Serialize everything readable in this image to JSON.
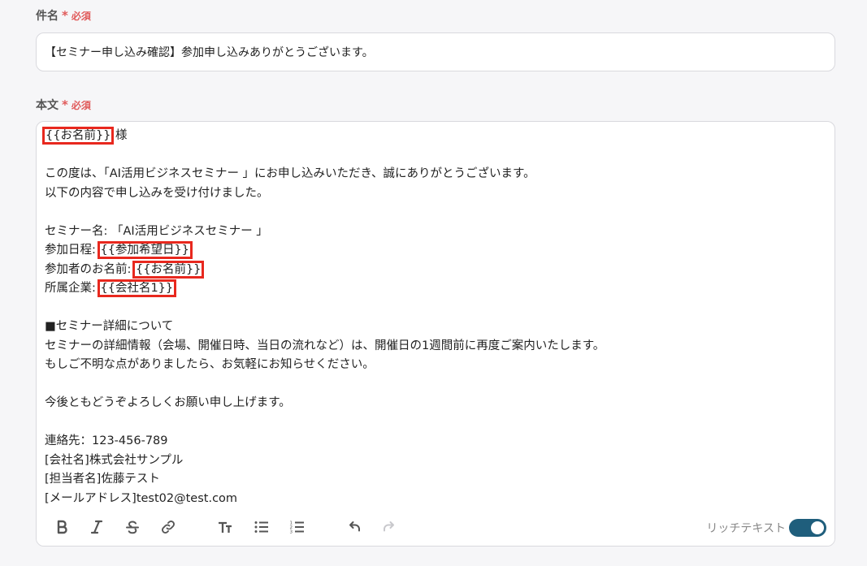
{
  "subject": {
    "label": "件名",
    "required_mark": "*",
    "required_text": "必須",
    "value": "【セミナー申し込み確認】参加申し込みありがとうございます。"
  },
  "body": {
    "label": "本文",
    "required_mark": "*",
    "required_text": "必須",
    "lines": {
      "l1_var": "{{お名前}}",
      "l1_text": " 様",
      "l3": "この度は、「AI活用ビジネスセミナー 」にお申し込みいただき、誠にありがとうございます。",
      "l4": "以下の内容で申し込みを受け付けました。",
      "l6": "セミナー名: 「AI活用ビジネスセミナー 」",
      "l7_text": "参加日程: ",
      "l7_var": "{{参加希望日}}",
      "l8_text": "参加者のお名前: ",
      "l8_var": "{{お名前}}",
      "l9_text": "所属企業: ",
      "l9_var": "{{会社名1}}",
      "l11": "■セミナー詳細について",
      "l12": "セミナーの詳細情報（会場、開催日時、当日の流れなど）は、開催日の1週間前に再度ご案内いたします。",
      "l13": "もしご不明な点がありましたら、お気軽にお知らせください。",
      "l15": "今後ともどうぞよろしくお願い申し上げます。",
      "l17": "連絡先：123-456-789",
      "l18": "[会社名]株式会社サンプル",
      "l19": "[担当者名]佐藤テスト",
      "l20": "[メールアドレス]test02@test.com"
    }
  },
  "toolbar": {
    "icons": [
      "bold-icon",
      "italic-icon",
      "strikethrough-icon",
      "link-icon",
      "text-size-icon",
      "bullet-list-icon",
      "numbered-list-icon",
      "undo-icon",
      "redo-icon"
    ],
    "rich_text_label": "リッチテキスト",
    "rich_text_enabled": true
  },
  "colors": {
    "required": "#e05a5a",
    "highlight_box": "#e8281e",
    "toggle_on": "#1f5e7c"
  }
}
